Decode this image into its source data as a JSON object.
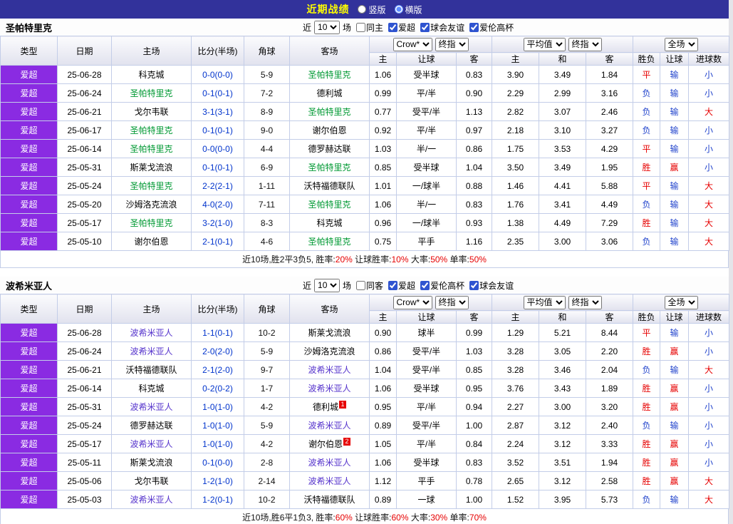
{
  "topbar": {
    "title": "近期战绩",
    "radios": [
      {
        "label": "竖版",
        "checked": false
      },
      {
        "label": "横版",
        "checked": true
      }
    ]
  },
  "colors": {
    "topbar_bg": "#32329b",
    "title": "#ffff00",
    "league_badge_bg": "#8a2be2",
    "score": "#0033cc",
    "win": "#e60000",
    "loss": "#2244cc"
  },
  "header": {
    "static_cols": [
      "类型",
      "日期",
      "主场",
      "比分(半场)",
      "角球",
      "客场"
    ],
    "odds_group": {
      "selects": [
        "Crow*",
        "终指"
      ],
      "cols": [
        "主",
        "让球",
        "客"
      ]
    },
    "avg_group": {
      "selects": [
        "平均值",
        "终指"
      ],
      "cols": [
        "主",
        "和",
        "客"
      ]
    },
    "result_group": {
      "selects": [
        "全场"
      ],
      "cols": [
        "胜负",
        "让球",
        "进球数"
      ]
    }
  },
  "sections": [
    {
      "team": "圣帕特里克",
      "team_color": "#009933",
      "filter": {
        "near_label": "近",
        "count": "10",
        "games_label": "场",
        "checkboxes": [
          {
            "label": "同主",
            "checked": false
          },
          {
            "label": "爱超",
            "checked": true
          },
          {
            "label": "球会友谊",
            "checked": true
          },
          {
            "label": "爱伦高杯",
            "checked": true
          }
        ]
      },
      "rows": [
        {
          "league": "爱超",
          "date": "25-06-28",
          "home": "科克城",
          "home_focus": false,
          "home_card": "",
          "score": "0-0(0-0)",
          "corners": "5-9",
          "away": "圣帕特里克",
          "away_focus": true,
          "away_card": "",
          "odds": [
            "1.06",
            "受半球",
            "0.83"
          ],
          "avg": [
            "3.90",
            "3.49",
            "1.84"
          ],
          "results": [
            "平",
            "输",
            "小"
          ]
        },
        {
          "league": "爱超",
          "date": "25-06-24",
          "home": "圣帕特里克",
          "home_focus": true,
          "home_card": "",
          "score": "0-1(0-1)",
          "corners": "7-2",
          "away": "德利城",
          "away_focus": false,
          "away_card": "",
          "odds": [
            "0.99",
            "平/半",
            "0.90"
          ],
          "avg": [
            "2.29",
            "2.99",
            "3.16"
          ],
          "results": [
            "负",
            "输",
            "小"
          ]
        },
        {
          "league": "爱超",
          "date": "25-06-21",
          "home": "戈尔韦联",
          "home_focus": false,
          "home_card": "",
          "score": "3-1(3-1)",
          "corners": "8-9",
          "away": "圣帕特里克",
          "away_focus": true,
          "away_card": "",
          "odds": [
            "0.77",
            "受平/半",
            "1.13"
          ],
          "avg": [
            "2.82",
            "3.07",
            "2.46"
          ],
          "results": [
            "负",
            "输",
            "大"
          ]
        },
        {
          "league": "爱超",
          "date": "25-06-17",
          "home": "圣帕特里克",
          "home_focus": true,
          "home_card": "",
          "score": "0-1(0-1)",
          "corners": "9-0",
          "away": "谢尔伯恩",
          "away_focus": false,
          "away_card": "",
          "odds": [
            "0.92",
            "平/半",
            "0.97"
          ],
          "avg": [
            "2.18",
            "3.10",
            "3.27"
          ],
          "results": [
            "负",
            "输",
            "小"
          ]
        },
        {
          "league": "爱超",
          "date": "25-06-14",
          "home": "圣帕特里克",
          "home_focus": true,
          "home_card": "",
          "score": "0-0(0-0)",
          "corners": "4-4",
          "away": "德罗赫达联",
          "away_focus": false,
          "away_card": "",
          "odds": [
            "1.03",
            "半/一",
            "0.86"
          ],
          "avg": [
            "1.75",
            "3.53",
            "4.29"
          ],
          "results": [
            "平",
            "输",
            "小"
          ]
        },
        {
          "league": "爱超",
          "date": "25-05-31",
          "home": "斯莱戈流浪",
          "home_focus": false,
          "home_card": "",
          "score": "0-1(0-1)",
          "corners": "6-9",
          "away": "圣帕特里克",
          "away_focus": true,
          "away_card": "",
          "odds": [
            "0.85",
            "受半球",
            "1.04"
          ],
          "avg": [
            "3.50",
            "3.49",
            "1.95"
          ],
          "results": [
            "胜",
            "赢",
            "小"
          ]
        },
        {
          "league": "爱超",
          "date": "25-05-24",
          "home": "圣帕特里克",
          "home_focus": true,
          "home_card": "",
          "score": "2-2(2-1)",
          "corners": "1-11",
          "away": "沃特福德联队",
          "away_focus": false,
          "away_card": "",
          "odds": [
            "1.01",
            "一/球半",
            "0.88"
          ],
          "avg": [
            "1.46",
            "4.41",
            "5.88"
          ],
          "results": [
            "平",
            "输",
            "大"
          ]
        },
        {
          "league": "爱超",
          "date": "25-05-20",
          "home": "沙姆洛克流浪",
          "home_focus": false,
          "home_card": "",
          "score": "4-0(2-0)",
          "corners": "7-11",
          "away": "圣帕特里克",
          "away_focus": true,
          "away_card": "",
          "odds": [
            "1.06",
            "半/一",
            "0.83"
          ],
          "avg": [
            "1.76",
            "3.41",
            "4.49"
          ],
          "results": [
            "负",
            "输",
            "大"
          ]
        },
        {
          "league": "爱超",
          "date": "25-05-17",
          "home": "圣帕特里克",
          "home_focus": true,
          "home_card": "",
          "score": "3-2(1-0)",
          "corners": "8-3",
          "away": "科克城",
          "away_focus": false,
          "away_card": "",
          "odds": [
            "0.96",
            "一/球半",
            "0.93"
          ],
          "avg": [
            "1.38",
            "4.49",
            "7.29"
          ],
          "results": [
            "胜",
            "输",
            "大"
          ]
        },
        {
          "league": "爱超",
          "date": "25-05-10",
          "home": "谢尔伯恩",
          "home_focus": false,
          "home_card": "",
          "score": "2-1(0-1)",
          "corners": "4-6",
          "away": "圣帕特里克",
          "away_focus": true,
          "away_card": "",
          "odds": [
            "0.75",
            "平手",
            "1.16"
          ],
          "avg": [
            "2.35",
            "3.00",
            "3.06"
          ],
          "results": [
            "负",
            "输",
            "大"
          ]
        }
      ],
      "summary": [
        {
          "text": "近10场,胜2平3负5, 胜率:",
          "red": false
        },
        {
          "text": "20%",
          "red": true
        },
        {
          "text": " 让球胜率:",
          "red": false
        },
        {
          "text": "10%",
          "red": true
        },
        {
          "text": " 大率:",
          "red": false
        },
        {
          "text": "50%",
          "red": true
        },
        {
          "text": " 单率:",
          "red": false
        },
        {
          "text": "50%",
          "red": true
        }
      ]
    },
    {
      "team": "波希米亚人",
      "team_color": "#5533cc",
      "filter": {
        "near_label": "近",
        "count": "10",
        "games_label": "场",
        "checkboxes": [
          {
            "label": "同客",
            "checked": false
          },
          {
            "label": "爱超",
            "checked": true
          },
          {
            "label": "爱伦高杯",
            "checked": true
          },
          {
            "label": "球会友谊",
            "checked": true
          }
        ]
      },
      "rows": [
        {
          "league": "爱超",
          "date": "25-06-28",
          "home": "波希米亚人",
          "home_focus": true,
          "home_card": "",
          "score": "1-1(0-1)",
          "corners": "10-2",
          "away": "斯莱戈流浪",
          "away_focus": false,
          "away_card": "",
          "odds": [
            "0.90",
            "球半",
            "0.99"
          ],
          "avg": [
            "1.29",
            "5.21",
            "8.44"
          ],
          "results": [
            "平",
            "输",
            "小"
          ]
        },
        {
          "league": "爱超",
          "date": "25-06-24",
          "home": "波希米亚人",
          "home_focus": true,
          "home_card": "",
          "score": "2-0(2-0)",
          "corners": "5-9",
          "away": "沙姆洛克流浪",
          "away_focus": false,
          "away_card": "",
          "odds": [
            "0.86",
            "受平/半",
            "1.03"
          ],
          "avg": [
            "3.28",
            "3.05",
            "2.20"
          ],
          "results": [
            "胜",
            "赢",
            "小"
          ]
        },
        {
          "league": "爱超",
          "date": "25-06-21",
          "home": "沃特福德联队",
          "home_focus": false,
          "home_card": "",
          "score": "2-1(2-0)",
          "corners": "9-7",
          "away": "波希米亚人",
          "away_focus": true,
          "away_card": "",
          "odds": [
            "1.04",
            "受平/半",
            "0.85"
          ],
          "avg": [
            "3.28",
            "3.46",
            "2.04"
          ],
          "results": [
            "负",
            "输",
            "大"
          ]
        },
        {
          "league": "爱超",
          "date": "25-06-14",
          "home": "科克城",
          "home_focus": false,
          "home_card": "",
          "score": "0-2(0-2)",
          "corners": "1-7",
          "away": "波希米亚人",
          "away_focus": true,
          "away_card": "",
          "odds": [
            "1.06",
            "受半球",
            "0.95"
          ],
          "avg": [
            "3.76",
            "3.43",
            "1.89"
          ],
          "results": [
            "胜",
            "赢",
            "小"
          ]
        },
        {
          "league": "爱超",
          "date": "25-05-31",
          "home": "波希米亚人",
          "home_focus": true,
          "home_card": "",
          "score": "1-0(1-0)",
          "corners": "4-2",
          "away": "德利城",
          "away_focus": false,
          "away_card": "1",
          "odds": [
            "0.95",
            "平/半",
            "0.94"
          ],
          "avg": [
            "2.27",
            "3.00",
            "3.20"
          ],
          "results": [
            "胜",
            "赢",
            "小"
          ]
        },
        {
          "league": "爱超",
          "date": "25-05-24",
          "home": "德罗赫达联",
          "home_focus": false,
          "home_card": "",
          "score": "1-0(1-0)",
          "corners": "5-9",
          "away": "波希米亚人",
          "away_focus": true,
          "away_card": "",
          "odds": [
            "0.89",
            "受平/半",
            "1.00"
          ],
          "avg": [
            "2.87",
            "3.12",
            "2.40"
          ],
          "results": [
            "负",
            "输",
            "小"
          ]
        },
        {
          "league": "爱超",
          "date": "25-05-17",
          "home": "波希米亚人",
          "home_focus": true,
          "home_card": "",
          "score": "1-0(1-0)",
          "corners": "4-2",
          "away": "谢尔伯恩",
          "away_focus": false,
          "away_card": "2",
          "odds": [
            "1.05",
            "平/半",
            "0.84"
          ],
          "avg": [
            "2.24",
            "3.12",
            "3.33"
          ],
          "results": [
            "胜",
            "赢",
            "小"
          ]
        },
        {
          "league": "爱超",
          "date": "25-05-11",
          "home": "斯莱戈流浪",
          "home_focus": false,
          "home_card": "",
          "score": "0-1(0-0)",
          "corners": "2-8",
          "away": "波希米亚人",
          "away_focus": true,
          "away_card": "",
          "odds": [
            "1.06",
            "受半球",
            "0.83"
          ],
          "avg": [
            "3.52",
            "3.51",
            "1.94"
          ],
          "results": [
            "胜",
            "赢",
            "小"
          ]
        },
        {
          "league": "爱超",
          "date": "25-05-06",
          "home": "戈尔韦联",
          "home_focus": false,
          "home_card": "",
          "score": "1-2(1-0)",
          "corners": "2-14",
          "away": "波希米亚人",
          "away_focus": true,
          "away_card": "",
          "odds": [
            "1.12",
            "平手",
            "0.78"
          ],
          "avg": [
            "2.65",
            "3.12",
            "2.58"
          ],
          "results": [
            "胜",
            "赢",
            "大"
          ]
        },
        {
          "league": "爱超",
          "date": "25-05-03",
          "home": "波希米亚人",
          "home_focus": true,
          "home_card": "",
          "score": "1-2(0-1)",
          "corners": "10-2",
          "away": "沃特福德联队",
          "away_focus": false,
          "away_card": "",
          "odds": [
            "0.89",
            "一球",
            "1.00"
          ],
          "avg": [
            "1.52",
            "3.95",
            "5.73"
          ],
          "results": [
            "负",
            "输",
            "大"
          ]
        }
      ],
      "summary": [
        {
          "text": "近10场,胜6平1负3, 胜率:",
          "red": false
        },
        {
          "text": "60%",
          "red": true
        },
        {
          "text": " 让球胜率:",
          "red": false
        },
        {
          "text": "60%",
          "red": true
        },
        {
          "text": " 大率:",
          "red": false
        },
        {
          "text": "30%",
          "red": true
        },
        {
          "text": " 单率:",
          "red": false
        },
        {
          "text": "70%",
          "red": true
        }
      ]
    }
  ]
}
